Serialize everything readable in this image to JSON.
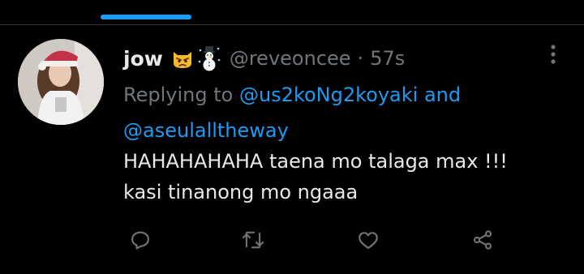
{
  "tweet": {
    "display_name": "jow",
    "emojis": [
      "angry-cat-emoji",
      "snowman-emoji"
    ],
    "handle": "@reveoncee",
    "separator": "·",
    "timestamp": "57s",
    "replying_prefix": "Replying to",
    "reply_mention_1": "@us2koNg2koyaki",
    "reply_conjunction": "and",
    "reply_mention_2": "@aseulalltheway",
    "text": "HAHAHAHAHA taena mo talaga max !!!\nkasi tinanong mo ngaaa"
  },
  "actions": [
    "reply-icon",
    "retweet-icon",
    "like-icon",
    "share-icon"
  ],
  "colors": {
    "background": "#000000",
    "primary_text": "#e7e9ea",
    "secondary_text": "#71767b",
    "accent": "#1d9bf0",
    "divider": "#2f3336"
  }
}
